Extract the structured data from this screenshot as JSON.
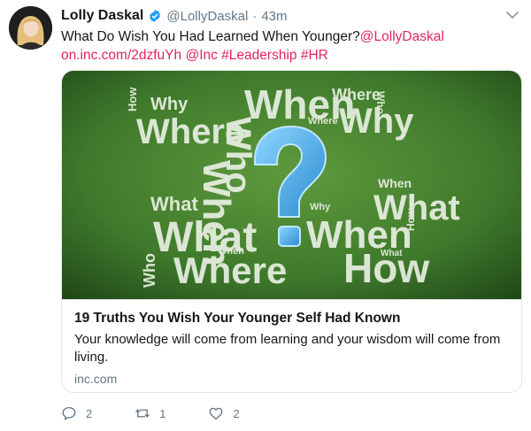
{
  "tweet": {
    "author_name": "Lolly Daskal",
    "author_handle": "@LollyDaskal",
    "separator": "·",
    "time": "43m",
    "text_main": "What Do Wish You Had Learned When Younger?",
    "mention": "@LollyDaskal",
    "url_text": "on.inc.com/2dzfuYh",
    "mention2": "@Inc",
    "hashtag1": "#Leadership",
    "hashtag2": "#HR"
  },
  "card": {
    "title": "19 Truths You Wish Your Younger Self Had Known",
    "description": "Your knowledge will come from learning and your wisdom will come from living.",
    "domain": "inc.com",
    "image_words": [
      "How",
      "Why",
      "Where",
      "Who",
      "When",
      "Where",
      "Why",
      "Where",
      "Who",
      "When",
      "What",
      "What",
      "What",
      "Why",
      "When",
      "When",
      "What",
      "How",
      "Who",
      "Where",
      "When",
      "How"
    ]
  },
  "actions": {
    "reply_count": "2",
    "retweet_count": "1",
    "like_count": "2"
  },
  "colors": {
    "link": "#e0245e",
    "muted": "#657786",
    "chalkboard": "#3f7a2c",
    "question_mark": "#4fb3e8"
  },
  "icons": [
    "verified-badge-icon",
    "caret-down-icon",
    "reply-icon",
    "retweet-icon",
    "like-icon",
    "question-mark-icon"
  ]
}
